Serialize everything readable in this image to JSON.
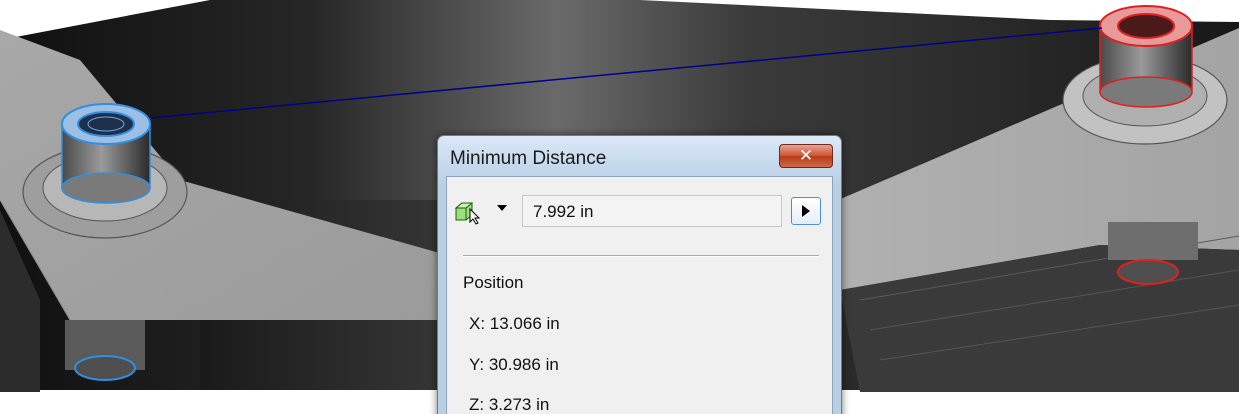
{
  "dialog": {
    "title": "Minimum Distance",
    "close_glyph": "✕",
    "selector_icon": "cube-cursor-icon",
    "distance_value": "7.992 in",
    "position_label": "Position",
    "x_value": "X: 13.066 in",
    "y_value": "Y: 30.986 in",
    "z_value": "Z: 3.273 in"
  },
  "colors": {
    "measure_line": "#00008b",
    "selected_part_a": "#2f8fe0",
    "selected_part_b": "#e02020",
    "close_button": "#c8502f"
  }
}
